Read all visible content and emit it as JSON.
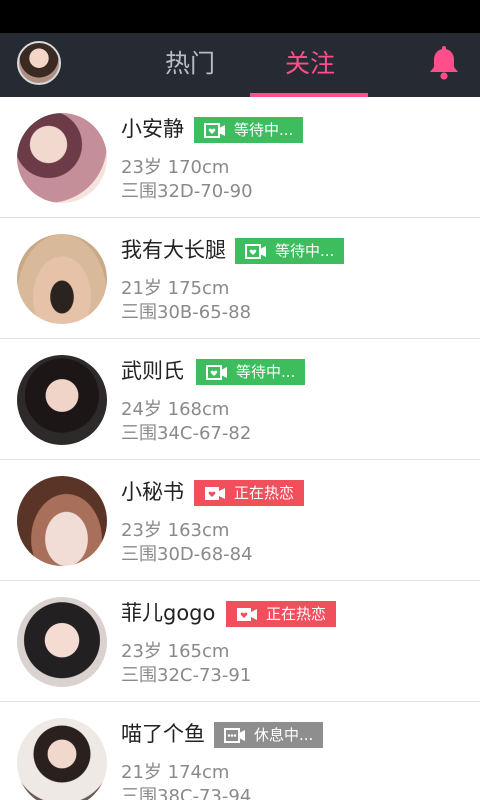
{
  "header": {
    "tabs": [
      {
        "label": "热门",
        "active": false
      },
      {
        "label": "关注",
        "active": true
      }
    ],
    "accent_color": "#ff4e8a",
    "bar_color": "#252a33",
    "icons": [
      "avatar",
      "bell-icon"
    ]
  },
  "list": [
    {
      "name": "小安静",
      "status": "等待中...",
      "status_type": "green",
      "age_height": "23岁 170cm",
      "measurements": "三围32D-70-90"
    },
    {
      "name": "我有大长腿",
      "status": "等待中...",
      "status_type": "green",
      "age_height": "21岁 175cm",
      "measurements": "三围30B-65-88"
    },
    {
      "name": "武则氏",
      "status": "等待中...",
      "status_type": "green",
      "age_height": "24岁 168cm",
      "measurements": "三围34C-67-82"
    },
    {
      "name": "小秘书",
      "status": "正在热恋",
      "status_type": "red",
      "age_height": "23岁 163cm",
      "measurements": "三围30D-68-84"
    },
    {
      "name": "菲儿gogo",
      "status": "正在热恋",
      "status_type": "red",
      "age_height": "23岁 165cm",
      "measurements": "三围32C-73-91"
    },
    {
      "name": "喵了个鱼",
      "status": "休息中...",
      "status_type": "gray",
      "age_height": "21岁 174cm",
      "measurements": "三围38C-73-94"
    }
  ],
  "status_colors": {
    "green": "#3ebd5e",
    "red": "#f24f5c",
    "gray": "#8e8e8e"
  }
}
